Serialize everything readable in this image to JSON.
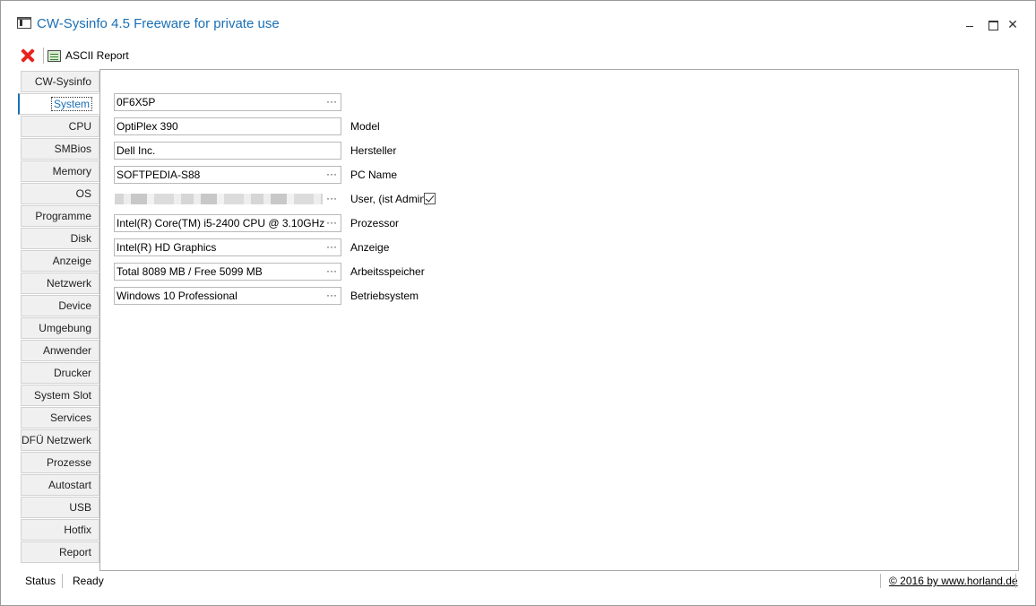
{
  "window": {
    "title": "CW-Sysinfo 4.5 Freeware for private use"
  },
  "toolbar": {
    "close_icon": "red-x-icon",
    "report_label": "ASCII Report"
  },
  "tabs": [
    {
      "label": "CW-Sysinfo"
    },
    {
      "label": "System",
      "active": true
    },
    {
      "label": "CPU"
    },
    {
      "label": "SMBios"
    },
    {
      "label": "Memory"
    },
    {
      "label": "OS"
    },
    {
      "label": "Programme"
    },
    {
      "label": "Disk"
    },
    {
      "label": "Anzeige"
    },
    {
      "label": "Netzwerk"
    },
    {
      "label": "Device"
    },
    {
      "label": "Umgebung"
    },
    {
      "label": "Anwender"
    },
    {
      "label": "Drucker"
    },
    {
      "label": "System Slot"
    },
    {
      "label": "Services"
    },
    {
      "label": "DFÜ Netzwerk"
    },
    {
      "label": "Prozesse"
    },
    {
      "label": "Autostart"
    },
    {
      "label": "USB"
    },
    {
      "label": "Hotfix"
    },
    {
      "label": "Report"
    }
  ],
  "fields": [
    {
      "value": "0F6X5P",
      "label": ""
    },
    {
      "value": "OptiPlex 390",
      "label": "Model"
    },
    {
      "value": "Dell Inc.",
      "label": "Hersteller"
    },
    {
      "value": "SOFTPEDIA-S88",
      "label": "PC Name"
    },
    {
      "value": "",
      "label": "User,  (ist Admin)",
      "blurred": true,
      "admin_checked": true
    },
    {
      "value": "Intel(R) Core(TM) i5-2400 CPU @ 3.10GHz",
      "label": "Prozessor"
    },
    {
      "value": "Intel(R) HD Graphics",
      "label": "Anzeige"
    },
    {
      "value": "Total 8089 MB / Free 5099 MB",
      "label": "Arbeitsspeicher"
    },
    {
      "value": "Windows 10 Professional",
      "label": "Betriebsystem"
    }
  ],
  "ellipsis": "···",
  "status": {
    "label": "Status",
    "value": "Ready",
    "copyright": "© 2016 by www.horland.de"
  },
  "colors": {
    "title": "#1a6fb5",
    "active_tab": "#1a6fb5",
    "close_icon": "#e8231c"
  }
}
